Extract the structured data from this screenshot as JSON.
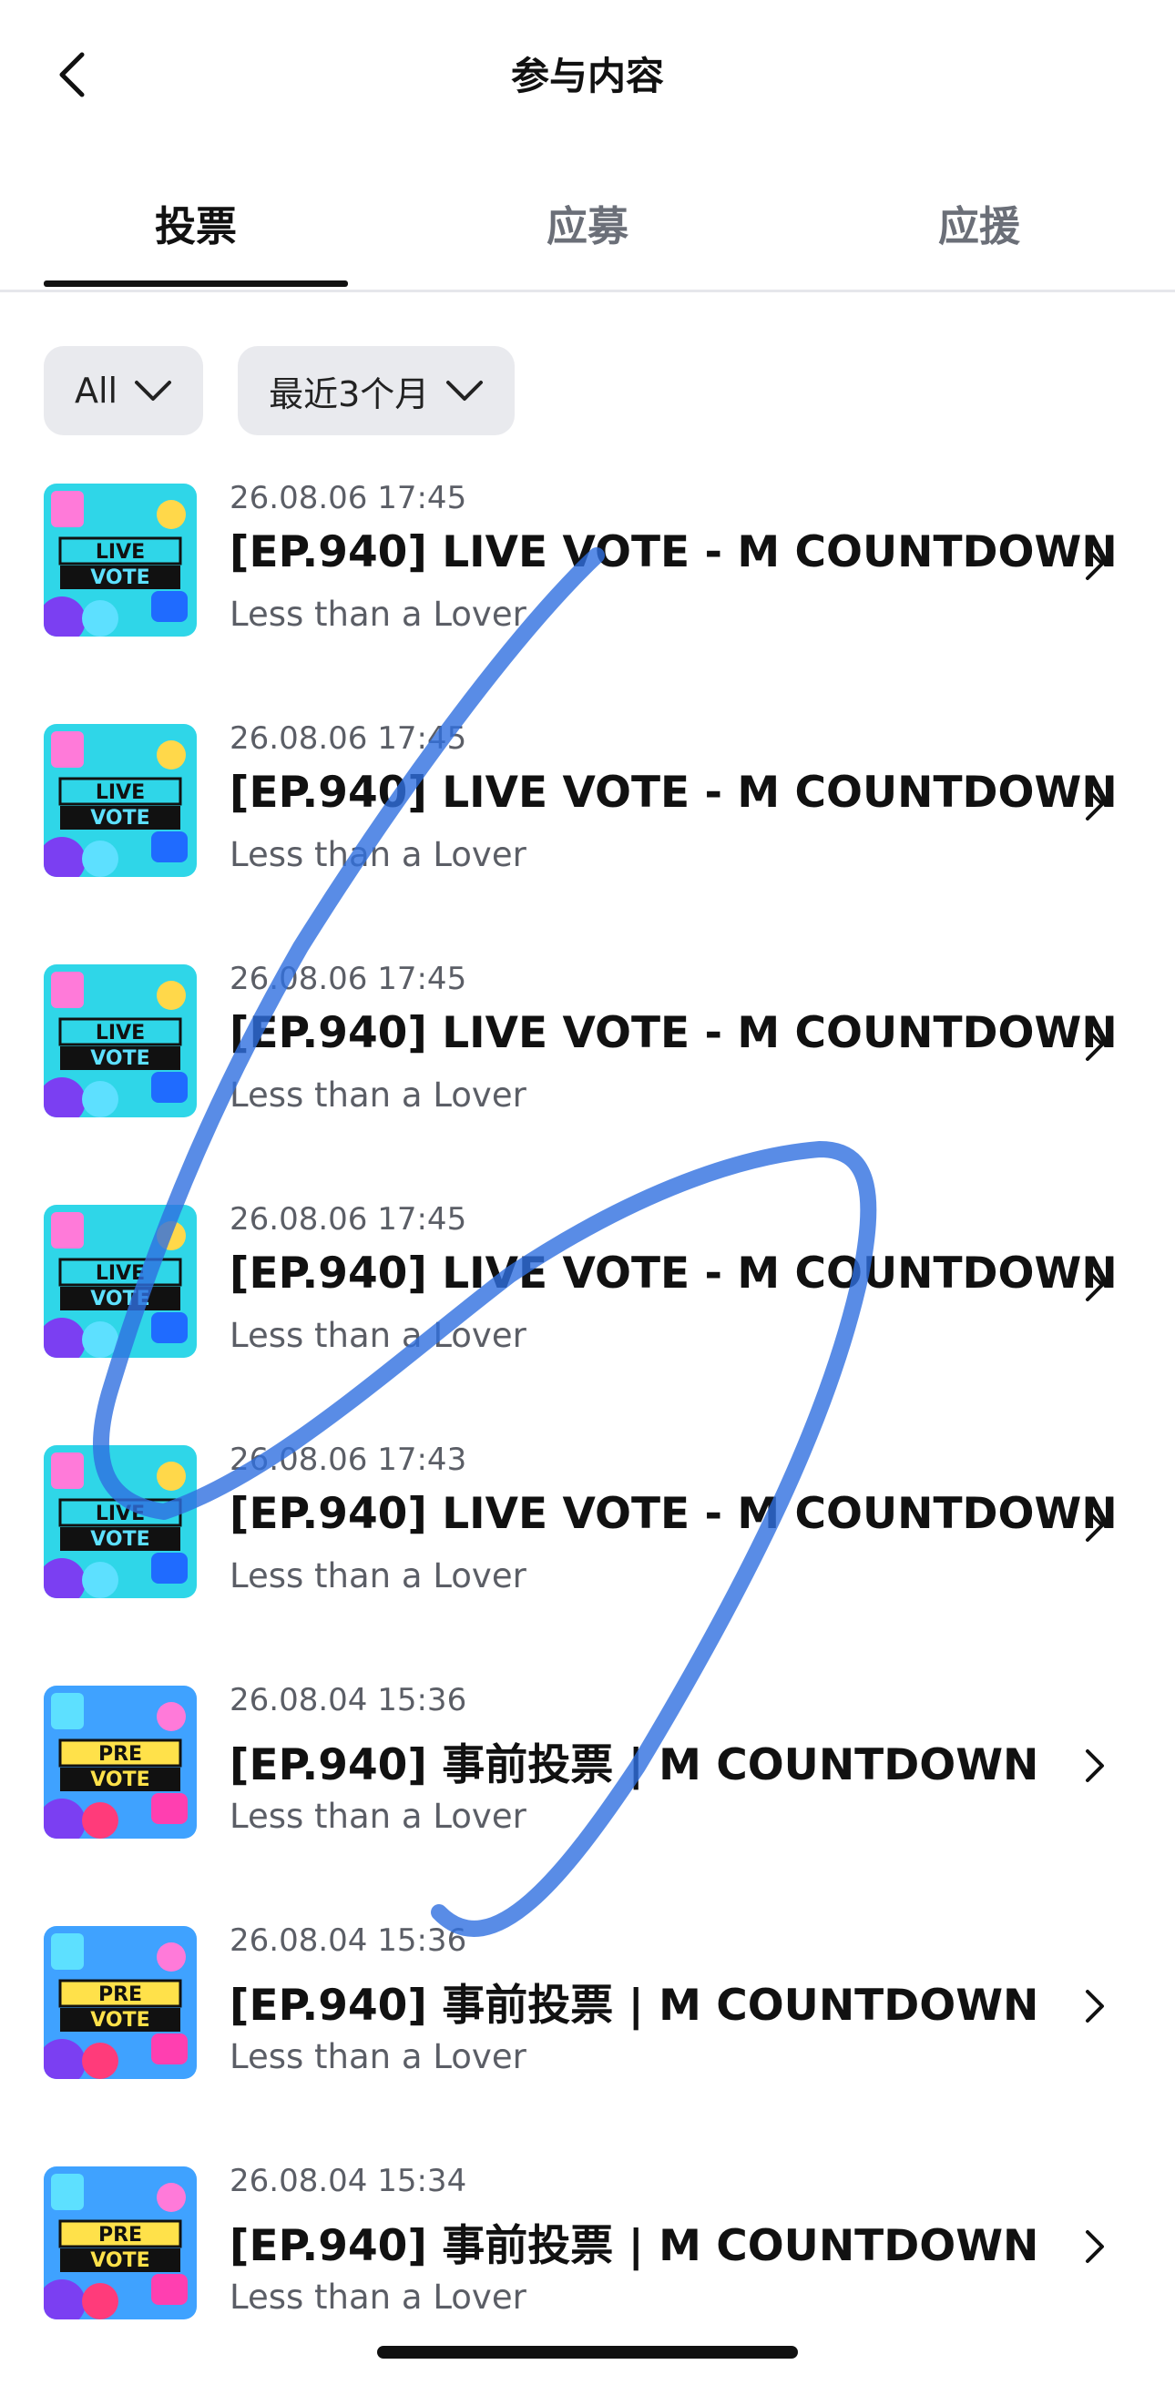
{
  "header": {
    "title": "参与内容"
  },
  "tabs": [
    {
      "label": "投票",
      "active": true
    },
    {
      "label": "应募",
      "active": false
    },
    {
      "label": "应援",
      "active": false
    }
  ],
  "filters": {
    "category": "All",
    "period": "最近3个月"
  },
  "items": [
    {
      "time": "26.08.06 17:45",
      "title": "[EP.940] LIVE VOTE - M COUNTDOWN",
      "subtitle": "Less than a Lover",
      "badge_top": "LIVE",
      "badge_bottom": "VOTE",
      "kind": "live"
    },
    {
      "time": "26.08.06 17:45",
      "title": "[EP.940] LIVE VOTE - M COUNTDOWN",
      "subtitle": "Less than a Lover",
      "badge_top": "LIVE",
      "badge_bottom": "VOTE",
      "kind": "live"
    },
    {
      "time": "26.08.06 17:45",
      "title": "[EP.940] LIVE VOTE - M COUNTDOWN",
      "subtitle": "Less than a Lover",
      "badge_top": "LIVE",
      "badge_bottom": "VOTE",
      "kind": "live"
    },
    {
      "time": "26.08.06 17:45",
      "title": "[EP.940] LIVE VOTE - M COUNTDOWN",
      "subtitle": "Less than a Lover",
      "badge_top": "LIVE",
      "badge_bottom": "VOTE",
      "kind": "live"
    },
    {
      "time": "26.08.06 17:43",
      "title": "[EP.940] LIVE VOTE - M COUNTDOWN",
      "subtitle": "Less than a Lover",
      "badge_top": "LIVE",
      "badge_bottom": "VOTE",
      "kind": "live"
    },
    {
      "time": "26.08.04 15:36",
      "title": "[EP.940] 事前投票 | M COUNTDOWN",
      "subtitle": "Less than a Lover",
      "badge_top": "PRE",
      "badge_bottom": "VOTE",
      "kind": "pre"
    },
    {
      "time": "26.08.04 15:36",
      "title": "[EP.940] 事前投票 | M COUNTDOWN",
      "subtitle": "Less than a Lover",
      "badge_top": "PRE",
      "badge_bottom": "VOTE",
      "kind": "pre"
    },
    {
      "time": "26.08.04 15:34",
      "title": "[EP.940] 事前投票 | M COUNTDOWN",
      "subtitle": "Less than a Lover",
      "badge_top": "PRE",
      "badge_bottom": "VOTE",
      "kind": "pre"
    }
  ],
  "colors": {
    "scribble": "#2f6fe0",
    "live_bg": "#2fd6e8",
    "pre_bg": "#3fa2ff",
    "pre_badge": "#ffe14a"
  }
}
